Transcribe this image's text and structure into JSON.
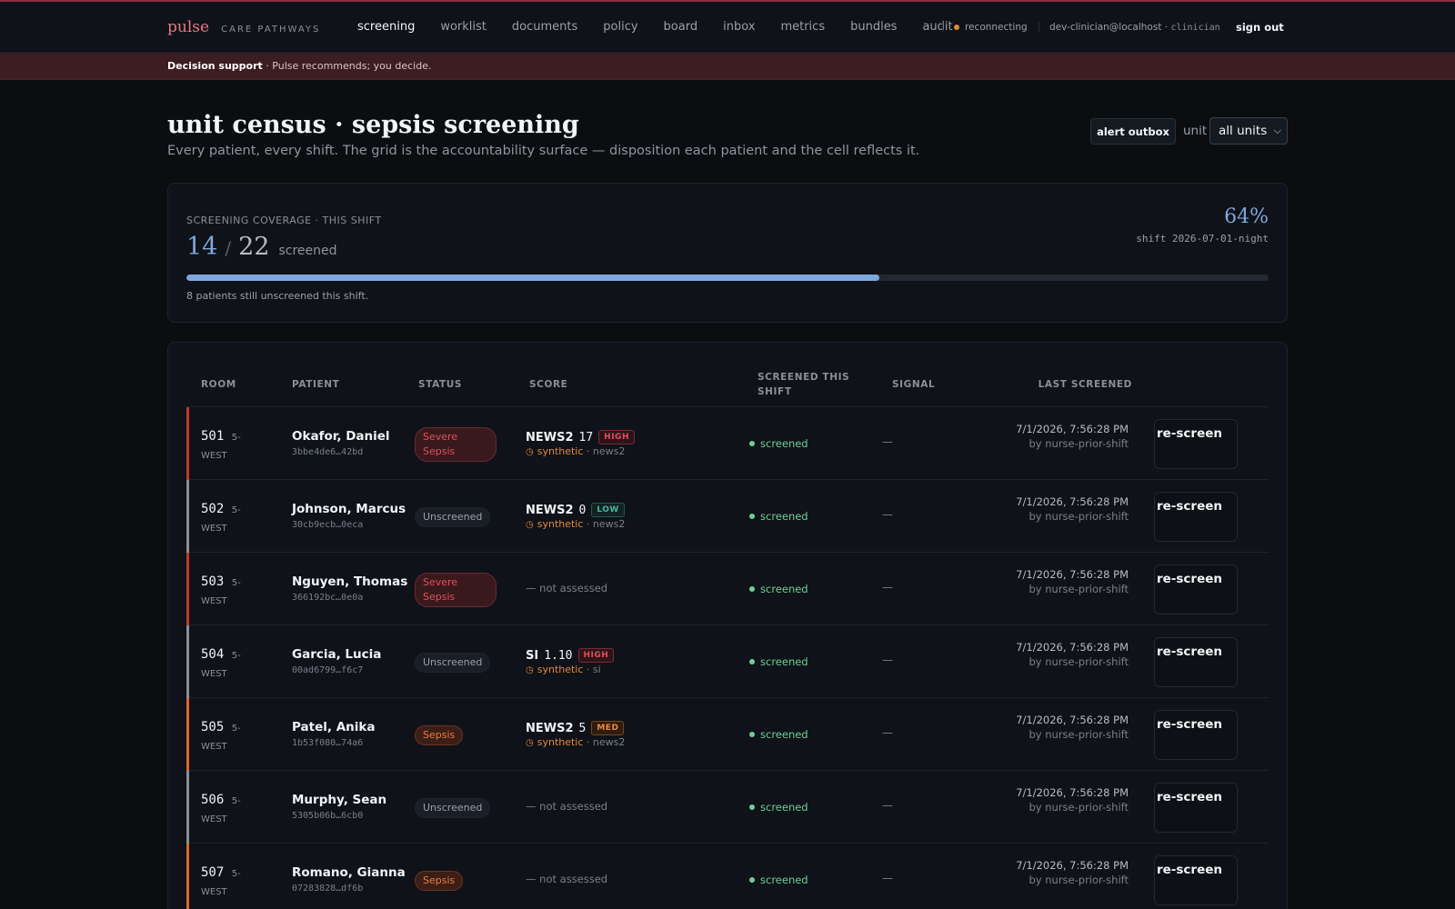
{
  "brand": {
    "logo": "pulse",
    "tagline": "CARE PATHWAYS"
  },
  "nav": {
    "items": [
      "screening",
      "worklist",
      "documents",
      "policy",
      "board",
      "inbox",
      "metrics",
      "bundles",
      "audit"
    ],
    "active": "screening"
  },
  "connection": {
    "status": "reconnecting",
    "dot_color": "#e08a3a"
  },
  "user": {
    "email": "dev-clinician@localhost",
    "separator": "·",
    "role": "clinician"
  },
  "signout_label": "sign out",
  "banner": {
    "bold": "Decision support",
    "text": "· Pulse recommends; you decide."
  },
  "page": {
    "title": "unit census · sepsis screening",
    "subtitle": "Every patient, every shift. The grid is the accountability surface — disposition each patient and the cell reflects it."
  },
  "controls": {
    "outbox_label": "alert outbox",
    "unit_label": "unit",
    "unit_value": "all units"
  },
  "coverage": {
    "label": "SCREENING COVERAGE · THIS SHIFT",
    "screened": "14",
    "total": "22",
    "slash": "/",
    "word": "screened",
    "percent_label": "64%",
    "progress_fraction": 0.64,
    "shift": "shift 2026-07-01-night",
    "note": "8 patients still unscreened this shift."
  },
  "table": {
    "columns": {
      "room": "ROOM",
      "patient": "PATIENT",
      "status": "STATUS",
      "score": "SCORE",
      "screened": "SCREENED THIS SHIFT",
      "signal": "SIGNAL",
      "last": "LAST SCREENED"
    },
    "rows": [
      {
        "room": "501",
        "unit": "5-WEST",
        "name": "Okafor, Daniel",
        "id": "3bbe4de6…42bd",
        "status": "Severe Sepsis",
        "status_kind": "severe",
        "bar_color": "#c0392b",
        "score_name": "NEWS2",
        "score_value": "17",
        "risk": "HIGH",
        "risk_kind": "high",
        "source": "synthetic",
        "source_detail": "· news2",
        "screened": "screened",
        "signal": "—",
        "last": "7/1/2026, 7:56:28 PM",
        "by": "by nurse-prior-shift",
        "action": "re-screen"
      },
      {
        "room": "502",
        "unit": "5-WEST",
        "name": "Johnson, Marcus",
        "id": "30cb9ecb…0eca",
        "status": "Unscreened",
        "status_kind": "unscreened",
        "bar_color": "#8a8f99",
        "score_name": "NEWS2",
        "score_value": "0",
        "risk": "LOW",
        "risk_kind": "low",
        "source": "synthetic",
        "source_detail": "· news2",
        "screened": "screened",
        "signal": "—",
        "last": "7/1/2026, 7:56:28 PM",
        "by": "by nurse-prior-shift",
        "action": "re-screen"
      },
      {
        "room": "503",
        "unit": "5-WEST",
        "name": "Nguyen, Thomas",
        "id": "366192bc…0e0a",
        "status": "Severe Sepsis",
        "status_kind": "severe",
        "bar_color": "#c0392b",
        "not_assessed": "— not assessed",
        "screened": "screened",
        "signal": "—",
        "last": "7/1/2026, 7:56:28 PM",
        "by": "by nurse-prior-shift",
        "action": "re-screen"
      },
      {
        "room": "504",
        "unit": "5-WEST",
        "name": "Garcia, Lucia",
        "id": "00ad6799…f6c7",
        "status": "Unscreened",
        "status_kind": "unscreened",
        "bar_color": "#8a8f99",
        "score_name": "SI",
        "score_value": "1.10",
        "risk": "HIGH",
        "risk_kind": "high",
        "source": "synthetic",
        "source_detail": "· si",
        "screened": "screened",
        "signal": "—",
        "last": "7/1/2026, 7:56:28 PM",
        "by": "by nurse-prior-shift",
        "action": "re-screen"
      },
      {
        "room": "505",
        "unit": "5-WEST",
        "name": "Patel, Anika",
        "id": "1b53f080…74a6",
        "status": "Sepsis",
        "status_kind": "sepsis",
        "bar_color": "#e0652f",
        "score_name": "NEWS2",
        "score_value": "5",
        "risk": "MED",
        "risk_kind": "med",
        "source": "synthetic",
        "source_detail": "· news2",
        "screened": "screened",
        "signal": "—",
        "last": "7/1/2026, 7:56:28 PM",
        "by": "by nurse-prior-shift",
        "action": "re-screen"
      },
      {
        "room": "506",
        "unit": "5-WEST",
        "name": "Murphy, Sean",
        "id": "5305b06b…6cb0",
        "status": "Unscreened",
        "status_kind": "unscreened",
        "bar_color": "#8a8f99",
        "not_assessed": "— not assessed",
        "screened": "screened",
        "signal": "—",
        "last": "7/1/2026, 7:56:28 PM",
        "by": "by nurse-prior-shift",
        "action": "re-screen"
      },
      {
        "room": "507",
        "unit": "5-WEST",
        "name": "Romano, Gianna",
        "id": "07283828…df6b",
        "status": "Sepsis",
        "status_kind": "sepsis",
        "bar_color": "#e0652f",
        "not_assessed": "— not assessed",
        "screened": "screened",
        "signal": "—",
        "last": "7/1/2026, 7:56:28 PM",
        "by": "by nurse-prior-shift",
        "action": "re-screen"
      }
    ]
  }
}
